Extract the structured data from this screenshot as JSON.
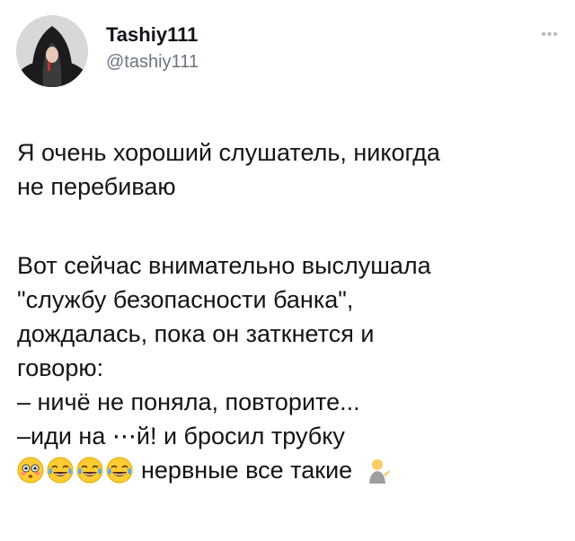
{
  "author": {
    "display_name": "Tashiy111",
    "handle": "@tashiy111"
  },
  "more_icon": "more-horizontal-icon",
  "tweet": {
    "paragraph1": [
      "Я очень хороший слушатель, никогда",
      "не перебиваю"
    ],
    "paragraph2": [
      "Вот сейчас внимательно выслушала",
      "\"службу безопасности банка\",",
      "дождалась,  пока он заткнется и",
      "говорю:",
      "– ничё не поняла,  повторите...",
      "–иди на ⋯й! и бросил трубку"
    ],
    "last_line_text": "нервные все такие"
  },
  "emojis": [
    "flushed-face-icon",
    "tears-of-joy-icon",
    "tears-of-joy-icon",
    "tears-of-joy-icon",
    "man-tipping-hand-icon"
  ]
}
